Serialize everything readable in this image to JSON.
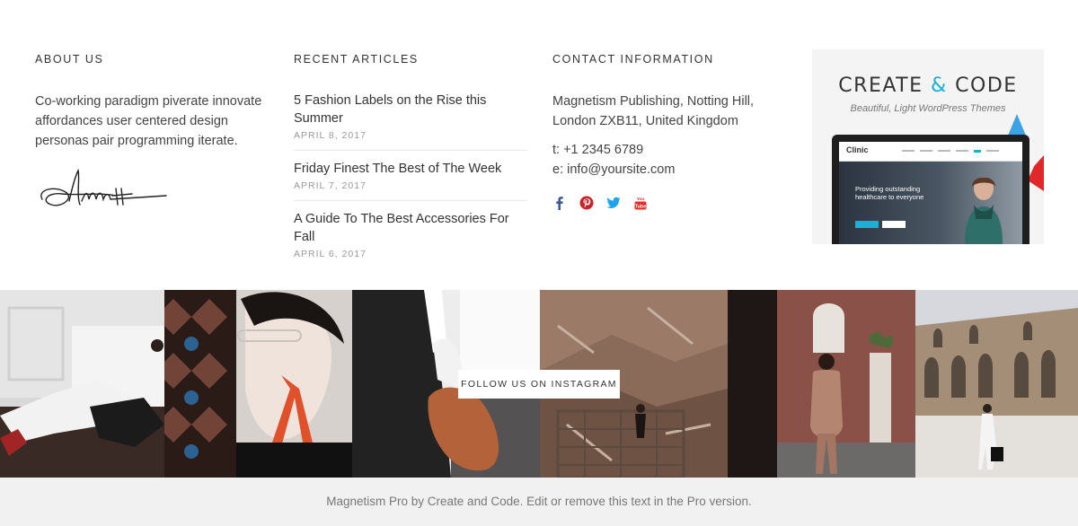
{
  "about": {
    "title": "ABOUT US",
    "text": "Co-working paradigm piverate innovate affordances user centered design personas pair programming iterate."
  },
  "articles": {
    "title": "RECENT ARTICLES",
    "items": [
      {
        "title": "5 Fashion Labels on the Rise this Summer",
        "date": "APRIL 8, 2017"
      },
      {
        "title": "Friday Finest The Best of The Week",
        "date": "APRIL 7, 2017"
      },
      {
        "title": "A Guide To The Best Accessories For Fall",
        "date": "APRIL 6, 2017"
      }
    ]
  },
  "contact": {
    "title": "CONTACT INFORMATION",
    "address_line1": "Magnetism Publishing, Notting Hill,",
    "address_line2": "London ZXB11, United Kingdom",
    "phone": "t: +1 2345 6789",
    "email": "e: info@yoursite.com",
    "socials": [
      "facebook-icon",
      "pinterest-icon",
      "twitter-icon",
      "youtube-icon"
    ]
  },
  "ad": {
    "title_part1": "CREATE ",
    "title_amp": "&",
    "title_part2": " CODE",
    "subtitle": "Beautiful, Light WordPress Themes",
    "screen_logo": "Clinic",
    "screen_hero": "Providing outstanding healthcare to everyone"
  },
  "instagram": {
    "button_label": "FOLLOW US ON INSTAGRAM"
  },
  "footer": {
    "copyright": "Magnetism Pro by Create and Code. Edit or remove this text in the Pro version."
  },
  "colors": {
    "accent": "#1ab0d6",
    "facebook": "#3b5998",
    "pinterest": "#cb2027",
    "twitter": "#1da1f2",
    "youtube": "#e52d27"
  }
}
